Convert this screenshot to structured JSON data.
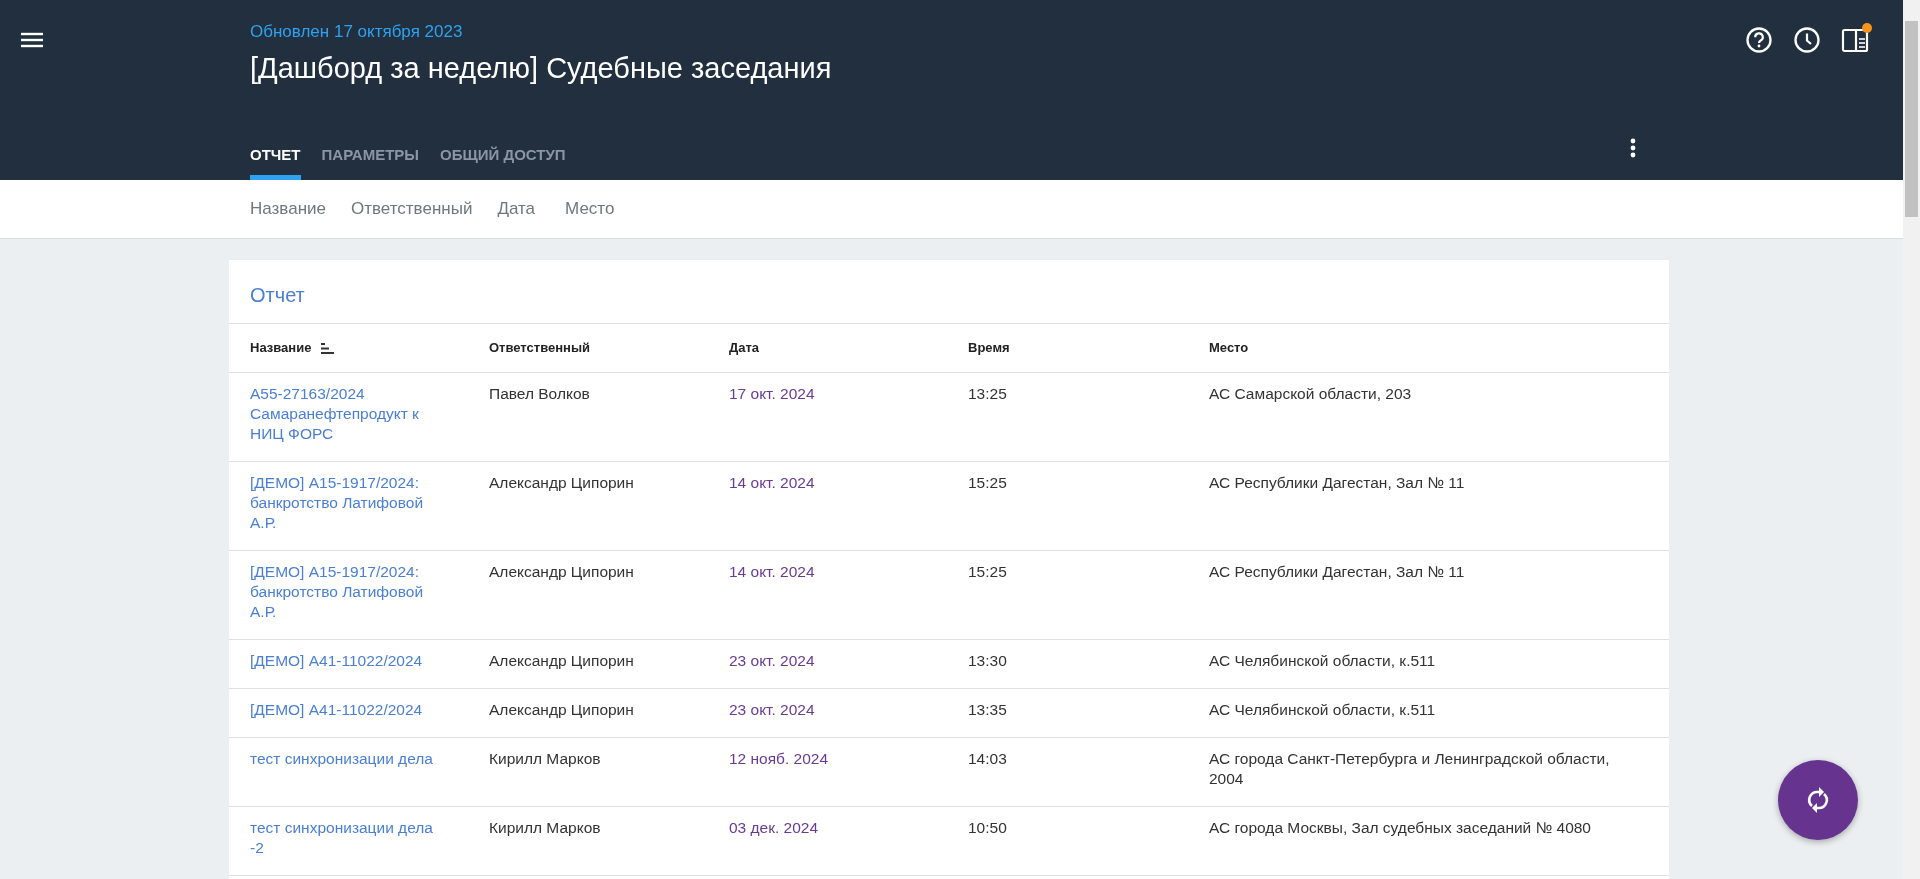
{
  "header": {
    "updated": "Обновлен 17 октября 2023",
    "title": "[Дашборд за неделю] Судебные заседания",
    "notification": true
  },
  "tabs": [
    {
      "label": "ОТЧЕТ",
      "selected": true
    },
    {
      "label": "ПАРАМЕТРЫ",
      "selected": false
    },
    {
      "label": "ОБЩИЙ ДОСТУП",
      "selected": false
    }
  ],
  "filters": [
    "Название",
    "Ответственный",
    "Дата",
    "Место"
  ],
  "report": {
    "title": "Отчет",
    "columns": [
      {
        "label": "Название",
        "sorted": true
      },
      {
        "label": "Ответственный",
        "sorted": false
      },
      {
        "label": "Дата",
        "sorted": false
      },
      {
        "label": "Время",
        "sorted": false
      },
      {
        "label": "Место",
        "sorted": false
      }
    ],
    "rows": [
      {
        "name": "А55-27163/2024 Самаранефтепродукт к НИЦ ФОРС",
        "owner": "Павел Волков",
        "date": "17 окт. 2024",
        "time": "13:25",
        "place": "АС Самарской области, 203"
      },
      {
        "name": "[ДЕМО] А15-1917/2024: банкротство Латифовой А.Р.",
        "owner": "Александр Ципорин",
        "date": "14 окт. 2024",
        "time": "15:25",
        "place": "АС Республики Дагестан, Зал № 11"
      },
      {
        "name": "[ДЕМО] А15-1917/2024: банкротство Латифовой А.Р.",
        "owner": "Александр Ципорин",
        "date": "14 окт. 2024",
        "time": "15:25",
        "place": "АС Республики Дагестан, Зал № 11"
      },
      {
        "name": "[ДЕМО] А41-11022/2024",
        "owner": "Александр Ципорин",
        "date": "23 окт. 2024",
        "time": "13:30",
        "place": "АС Челябинской области, к.511"
      },
      {
        "name": "[ДЕМО] А41-11022/2024",
        "owner": "Александр Ципорин",
        "date": "23 окт. 2024",
        "time": "13:35",
        "place": "АС Челябинской области, к.511"
      },
      {
        "name": "тест синхронизации дела",
        "owner": "Кирилл Марков",
        "date": "12 нояб. 2024",
        "time": "14:03",
        "place": "АС города Санкт-Петербурга и Ленинградской области, 2004"
      },
      {
        "name": "тест синхронизации дела -2",
        "owner": "Кирилл Марков",
        "date": "03 дек. 2024",
        "time": "10:50",
        "place": "АС города Москвы, Зал судебных заседаний № 4080"
      }
    ]
  }
}
